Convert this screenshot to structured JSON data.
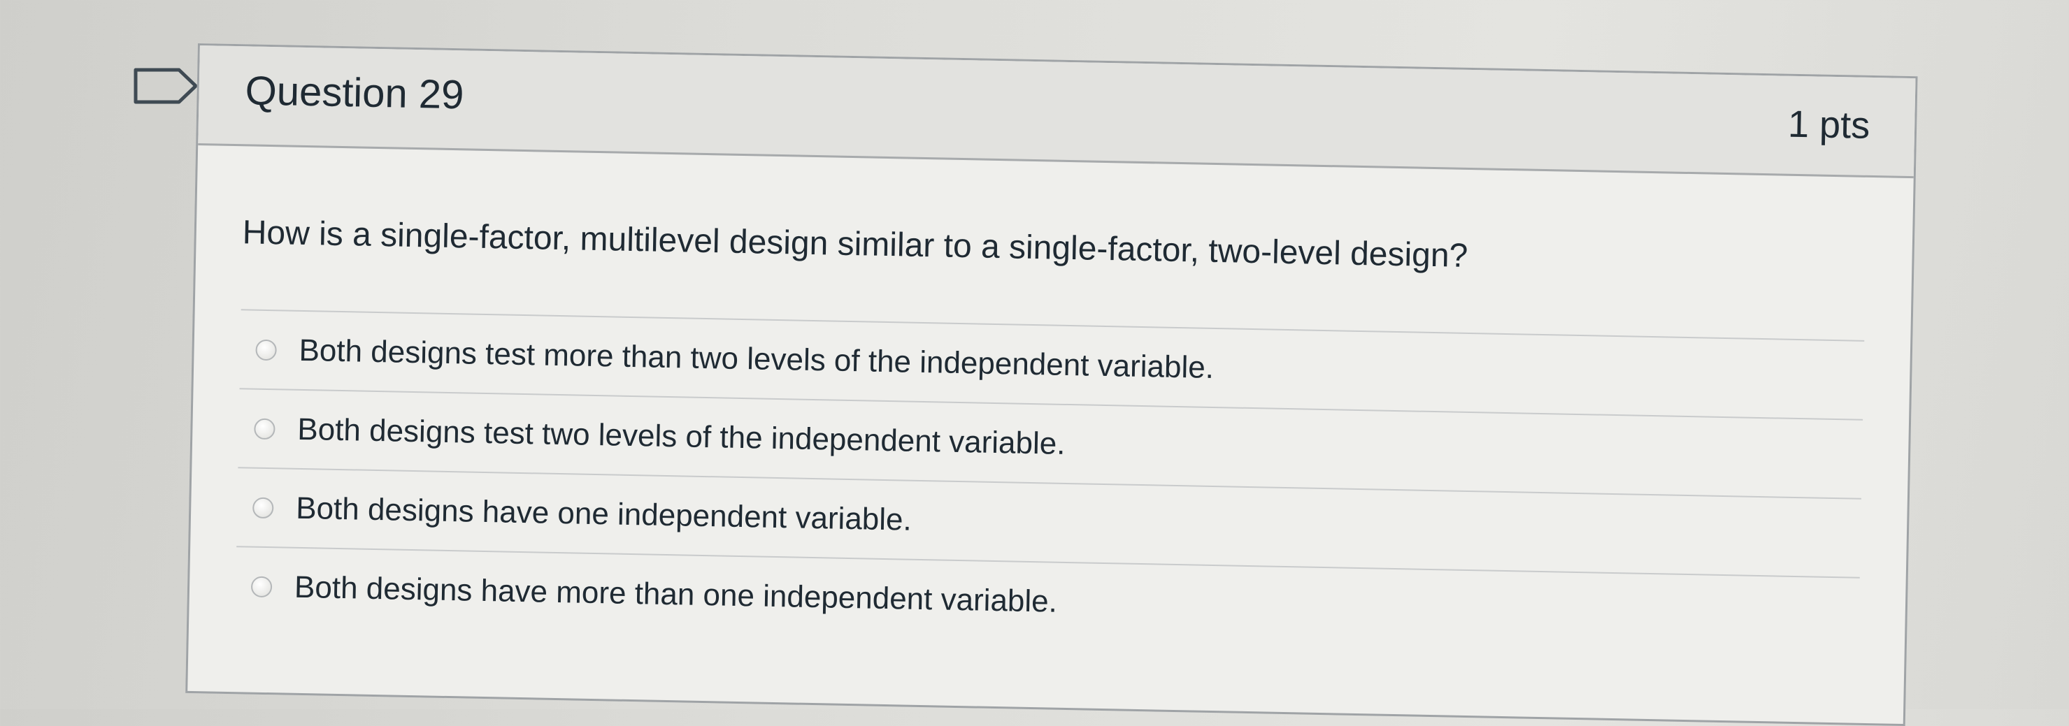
{
  "question": {
    "name": "Question 29",
    "points": "1 pts",
    "text": "How is a single-factor, multilevel design similar to a single-factor, two-level design?",
    "answers": [
      "Both designs test more than two levels of the independent variable.",
      "Both designs test two levels of the independent variable.",
      "Both designs have one independent variable.",
      "Both designs have more than one independent variable."
    ]
  },
  "icons": {
    "flag": "flag-question-icon",
    "radio": "radio-unselected-icon"
  },
  "colors": {
    "text": "#1f2a33",
    "border": "#9fa3a6",
    "header_bg": "#e2e2df",
    "body_bg": "#efefec"
  }
}
